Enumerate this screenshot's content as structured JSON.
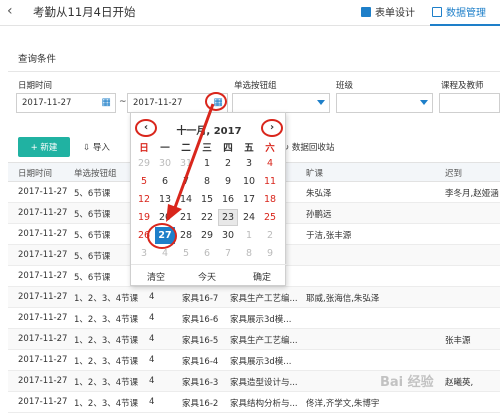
{
  "header": {
    "back_icon": "back-chevron-icon",
    "title": "考勤从11月4日开始",
    "tabs": [
      {
        "label": "表单设计",
        "icon": "form-icon"
      },
      {
        "label": "数据管理",
        "icon": "data-icon",
        "active": true
      }
    ],
    "accent": "#1e7fc9"
  },
  "query": {
    "title": "查询条件",
    "date_label": "日期时间",
    "date_from": "2017-11-27",
    "date_sep": "~",
    "date_to": "2017-11-27",
    "radio_group_label": "单选按钮组",
    "class_label": "班级",
    "course_label": "课程及教师"
  },
  "toolbar": {
    "new_label": "+ 新建",
    "import_label": "导入",
    "recycle_label": "数据回收站"
  },
  "table": {
    "headers": [
      "日期时间",
      "单选按钮组",
      "旷课",
      "迟到"
    ],
    "rows": [
      [
        "2017-11-27",
        "5、6节课",
        "",
        "",
        "",
        "朱弘泽",
        "李冬月,赵娅涵"
      ],
      [
        "2017-11-27",
        "5、6节课",
        "",
        "",
        "",
        "孙鹏远",
        ""
      ],
      [
        "2017-11-27",
        "5、6节课",
        "",
        "",
        "",
        "于洁,张丰源",
        ""
      ],
      [
        "2017-11-27",
        "5、6节课",
        "",
        "",
        "",
        "",
        ""
      ],
      [
        "2017-11-27",
        "5、6节课",
        "",
        "",
        "",
        "",
        ""
      ],
      [
        "2017-11-27",
        "1、2、3、4节课",
        "4",
        "家具16-7",
        "家具生产工艺编...",
        "耶威,张海信,朱弘泽",
        ""
      ],
      [
        "2017-11-27",
        "1、2、3、4节课",
        "4",
        "家具16-6",
        "家具展示3d模...",
        "",
        ""
      ],
      [
        "2017-11-27",
        "1、2、3、4节课",
        "4",
        "家具16-5",
        "家具生产工艺编...",
        "",
        "张丰源"
      ],
      [
        "2017-11-27",
        "1、2、3、4节课",
        "4",
        "家具16-4",
        "家具展示3d模...",
        "",
        ""
      ],
      [
        "2017-11-27",
        "1、2、3、4节课",
        "4",
        "家具16-3",
        "家具造型设计与...",
        "",
        "赵曦英,"
      ],
      [
        "2017-11-27",
        "1、2、3、4节课",
        "4",
        "家具16-2",
        "家具结构分析与...",
        "佟洋,齐学文,朱博宇",
        ""
      ]
    ]
  },
  "calendar": {
    "title": "十一月, 2017",
    "prev_icon": "chevron-left-icon",
    "next_icon": "chevron-right-icon",
    "weekdays": [
      "日",
      "一",
      "二",
      "三",
      "四",
      "五",
      "六"
    ],
    "weeks": [
      [
        "29",
        "30",
        "31",
        "1",
        "2",
        "3",
        "4"
      ],
      [
        "5",
        "6",
        "7",
        "8",
        "9",
        "10",
        "11"
      ],
      [
        "12",
        "13",
        "14",
        "15",
        "16",
        "17",
        "18"
      ],
      [
        "19",
        "20",
        "21",
        "22",
        "23",
        "24",
        "25"
      ],
      [
        "26",
        "27",
        "28",
        "29",
        "30",
        "1",
        "2"
      ],
      [
        "3",
        "4",
        "5",
        "6",
        "7",
        "8",
        "9"
      ]
    ],
    "selected": "27",
    "today": "23",
    "clear_label": "清空",
    "today_label": "今天",
    "ok_label": "确定",
    "annotation_color": "#d9261c"
  },
  "watermark": "Bai 经验"
}
